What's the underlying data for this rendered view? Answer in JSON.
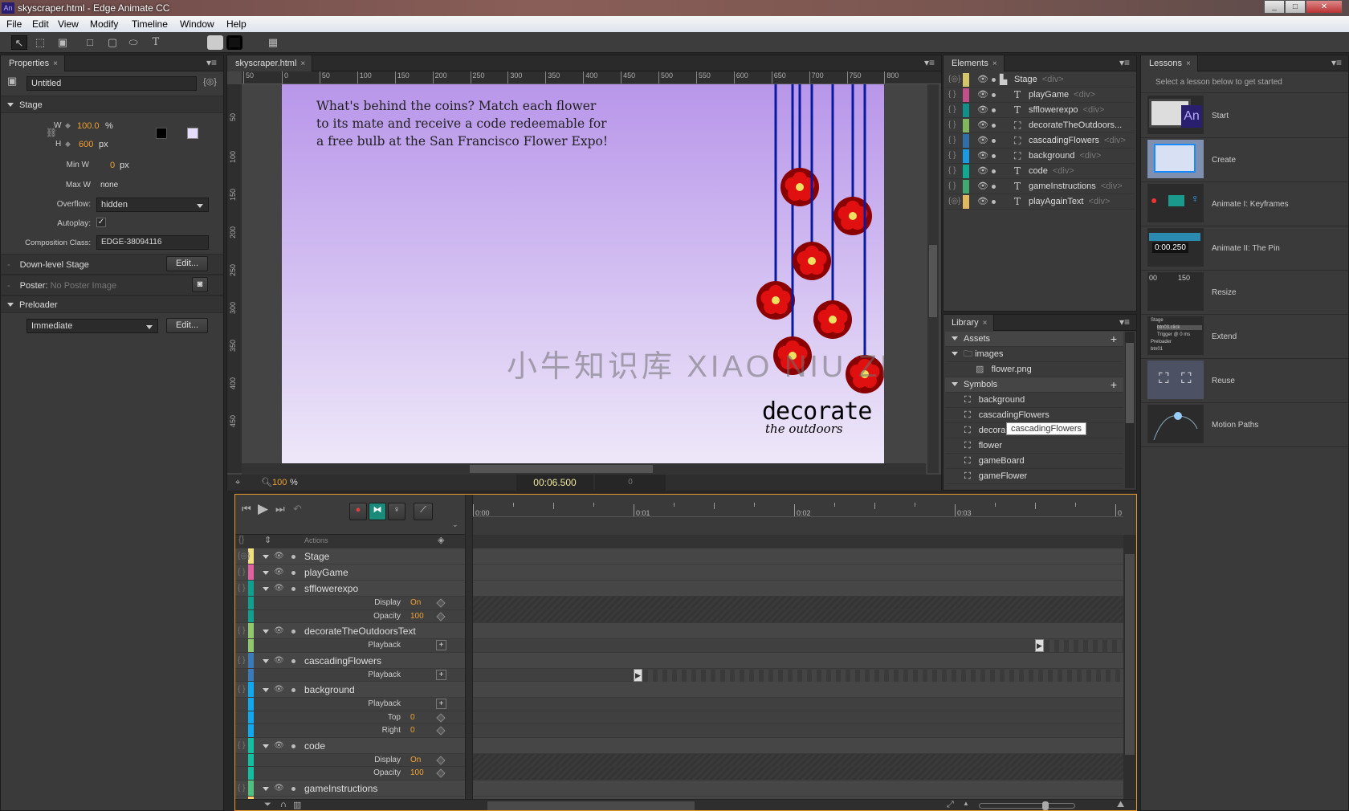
{
  "window": {
    "title": "skyscraper.html - Edge Animate CC",
    "app_icon": "An",
    "controls": [
      "minimize",
      "maximize",
      "close"
    ]
  },
  "menu": [
    "File",
    "Edit",
    "View",
    "Modify",
    "Timeline",
    "Window",
    "Help"
  ],
  "toolbar": {
    "tools": [
      "selection-tool",
      "transform-tool",
      "clipping-tool",
      "rectangle-tool",
      "rounded-rectangle-tool",
      "ellipse-tool",
      "text-tool"
    ],
    "fill_color": "#cccccc",
    "stroke_color": "#000000"
  },
  "properties": {
    "tab": "Properties",
    "name": "Untitled",
    "section_stage": "Stage",
    "w_label": "W",
    "w_value": "100.0",
    "w_unit": "%",
    "h_label": "H",
    "h_value": "600",
    "h_unit": "px",
    "stage_border_color": "#000000",
    "stage_bg_color": "#e6dcff",
    "minw_label": "Min W",
    "minw_value": "0",
    "minw_unit": "px",
    "maxw_label": "Max W",
    "maxw_value": "none",
    "overflow_label": "Overflow:",
    "overflow_value": "hidden",
    "autoplay_label": "Autoplay:",
    "autoplay_checked": true,
    "composition_label": "Composition Class:",
    "composition_value": "EDGE-38094116",
    "downlevel_label": "Down-level Stage",
    "edit_label": "Edit...",
    "poster_label": "Poster:",
    "poster_value": "No Poster Image",
    "preloader_label": "Preloader",
    "preloader_value": "Immediate"
  },
  "stage": {
    "tab": "skyscraper.html",
    "ruler_x": [
      "50",
      "0",
      "50",
      "100",
      "150",
      "200",
      "250",
      "300",
      "350",
      "400",
      "450",
      "500",
      "550",
      "600",
      "650",
      "700",
      "750",
      "800"
    ],
    "ruler_y": [
      "50",
      "100",
      "150",
      "200",
      "250",
      "300",
      "350",
      "400",
      "450"
    ],
    "instructions": [
      "What's behind the coins? Match each flower",
      "to its mate and receive a code redeemable for",
      "a free bulb at the San Francisco Flower Expo!"
    ],
    "logo_main": "decorate",
    "logo_sub": "the outdoors",
    "watermark": "小牛知识库 XIAO NIU ZHI SHI KU",
    "zoom": "100",
    "zoom_unit": "%",
    "time": "00:06.500",
    "offset": "0",
    "colors": {
      "stage_top": "#b896ea",
      "stage_bottom": "#eee8f9",
      "string": "#0a1aa0",
      "flower": "#e01010"
    }
  },
  "elements": {
    "tab": "Elements",
    "items": [
      {
        "name": "Stage",
        "tag": "<div>",
        "color": "#d4c46a",
        "icon": "stage",
        "indent": 0
      },
      {
        "name": "playGame",
        "tag": "<div>",
        "color": "#c0508a",
        "icon": "text",
        "indent": 1
      },
      {
        "name": "sfflowerexpo",
        "tag": "<div>",
        "color": "#10908a",
        "icon": "text",
        "indent": 1
      },
      {
        "name": "decorateTheOutdoors...",
        "tag": "",
        "color": "#80b860",
        "icon": "symbol",
        "indent": 1
      },
      {
        "name": "cascadingFlowers",
        "tag": "<div>",
        "color": "#3070a8",
        "icon": "symbol",
        "indent": 1
      },
      {
        "name": "background",
        "tag": "<div>",
        "color": "#1a9ae0",
        "icon": "symbol",
        "indent": 1
      },
      {
        "name": "code",
        "tag": "<div>",
        "color": "#10a890",
        "icon": "text",
        "indent": 1
      },
      {
        "name": "gameInstructions",
        "tag": "<div>",
        "color": "#40a870",
        "icon": "text",
        "indent": 1
      },
      {
        "name": "playAgainText",
        "tag": "<div>",
        "color": "#e0b860",
        "icon": "text",
        "indent": 1
      }
    ]
  },
  "library": {
    "tab": "Library",
    "assets": "Assets",
    "images_folder": "images",
    "image_file": "flower.png",
    "symbols": "Symbols",
    "symbol_items": [
      "background",
      "cascadingFlowers",
      "decorateTheOutdoorsText",
      "flower",
      "gameBoard",
      "gameFlower"
    ],
    "symbol_visible": [
      "background",
      "cascadingFlowers",
      "decora",
      "flower",
      "gameBoard",
      "gameFlower"
    ],
    "tooltip": "cascadingFlowers"
  },
  "lessons": {
    "tab": "Lessons",
    "intro": "Select a lesson below to get started",
    "items": [
      "Start",
      "Create",
      "Animate I: Keyframes",
      "Animate II: The Pin",
      "Resize",
      "Extend",
      "Reuse",
      "Motion Paths"
    ],
    "thumb_text": {
      "an": "An",
      "pin_time": "0:00.250",
      "resize_a": "00",
      "resize_b": "150",
      "extend": [
        "Stage",
        "btn03.click",
        "Trigger @ 0 ms",
        "Preloader",
        "btn01"
      ]
    }
  },
  "timeline": {
    "actions_label": "Actions",
    "ruler": [
      "0:00",
      "0:01",
      "0:02",
      "0:03",
      "0"
    ],
    "rows": [
      {
        "type": "el",
        "name": "Stage",
        "color": "#f0e080"
      },
      {
        "type": "el",
        "name": "playGame",
        "color": "#e060a0"
      },
      {
        "type": "el",
        "name": "sfflowerexpo",
        "color": "#10a090"
      },
      {
        "type": "prop",
        "name": "Display",
        "value": "On",
        "color": "#10a090",
        "kf": true,
        "hatch": true
      },
      {
        "type": "prop",
        "name": "Opacity",
        "value": "100",
        "color": "#10a090",
        "kf": true,
        "hatch": true
      },
      {
        "type": "el",
        "name": "decorateTheOutdoorsText",
        "color": "#90c870"
      },
      {
        "type": "prop",
        "name": "Playback",
        "value": "",
        "color": "#90c870",
        "add": true,
        "play_at": 3.5
      },
      {
        "type": "el",
        "name": "cascadingFlowers",
        "color": "#3a7ab8"
      },
      {
        "type": "prop",
        "name": "Playback",
        "value": "",
        "color": "#3a7ab8",
        "add": true,
        "play_at": 1.0
      },
      {
        "type": "el",
        "name": "background",
        "color": "#10a8f0"
      },
      {
        "type": "prop",
        "name": "Playback",
        "value": "",
        "color": "#10a8f0",
        "add": true
      },
      {
        "type": "prop",
        "name": "Top",
        "value": "0",
        "color": "#10a8f0",
        "kf": true
      },
      {
        "type": "prop",
        "name": "Right",
        "value": "0",
        "color": "#10a8f0",
        "kf": true
      },
      {
        "type": "el",
        "name": "code",
        "color": "#10c0a0"
      },
      {
        "type": "prop",
        "name": "Display",
        "value": "On",
        "color": "#10c0a0",
        "kf": true,
        "hatch": true
      },
      {
        "type": "prop",
        "name": "Opacity",
        "value": "100",
        "color": "#10c0a0",
        "kf": true,
        "hatch": true
      },
      {
        "type": "el",
        "name": "gameInstructions",
        "color": "#50c080"
      },
      {
        "type": "el",
        "name": "playAgainText",
        "color": "#f8d070"
      }
    ],
    "zoom_level": 0.7
  }
}
